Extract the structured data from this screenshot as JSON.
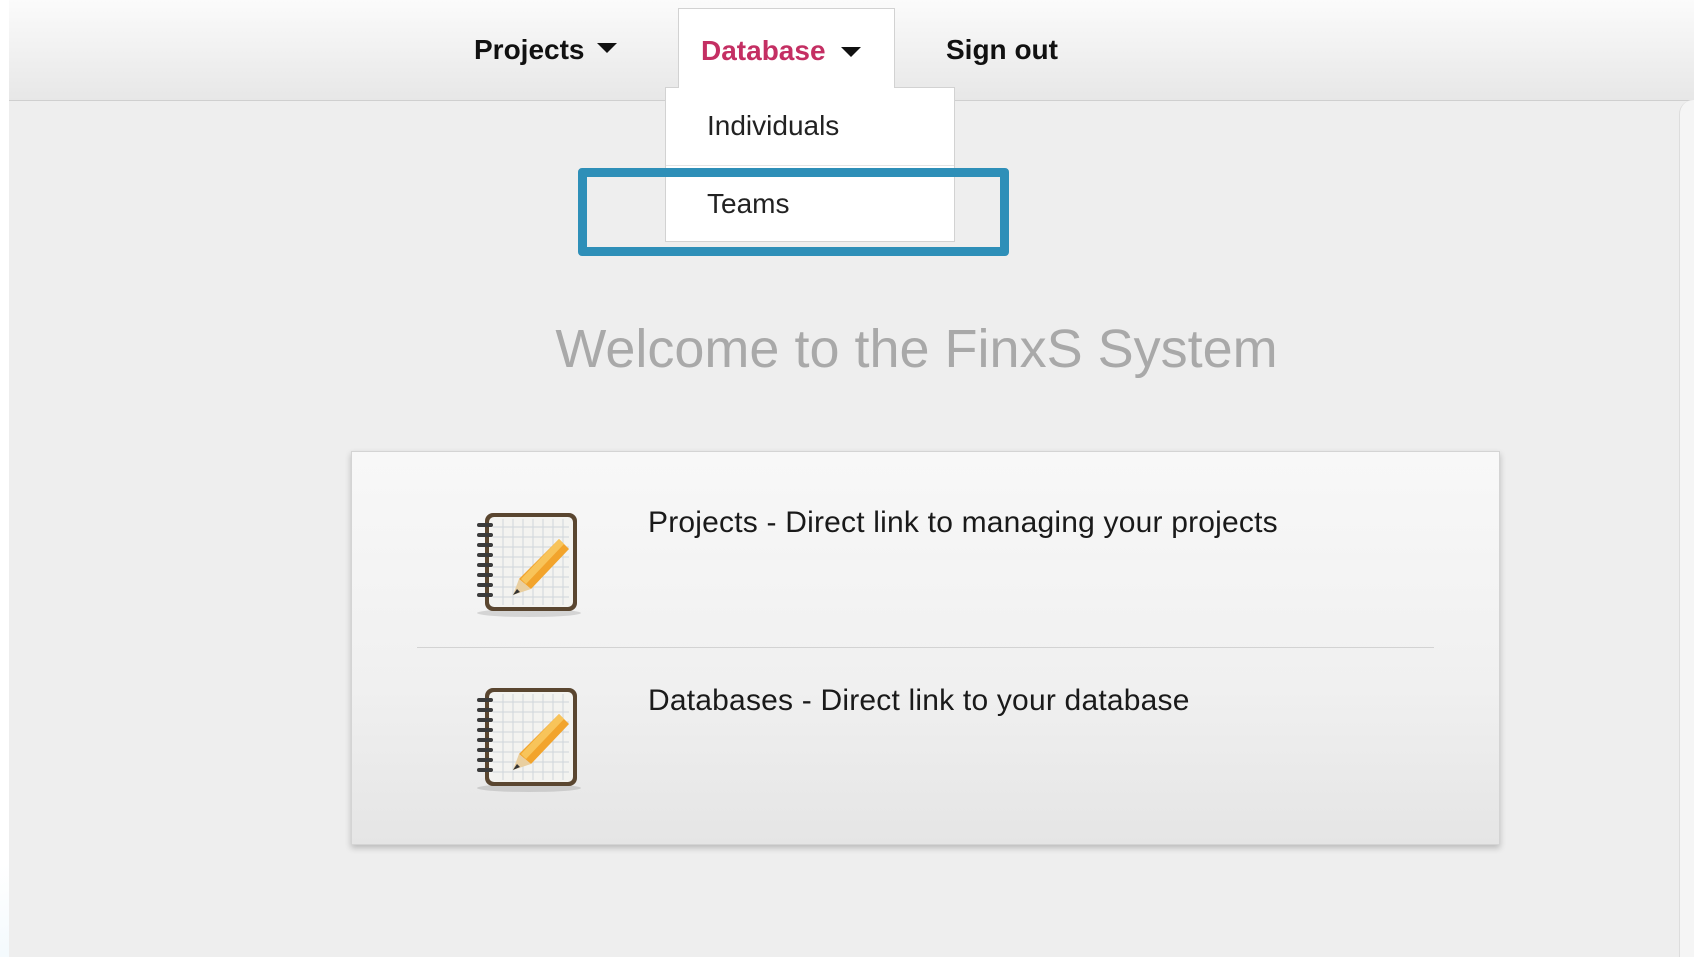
{
  "navbar": {
    "projects_label": "Projects",
    "database_label": "Database",
    "signout_label": "Sign out"
  },
  "dropdown": {
    "items": [
      {
        "label": "Individuals"
      },
      {
        "label": "Teams"
      }
    ]
  },
  "main": {
    "welcome_title": "Welcome to the FinxS System",
    "links": [
      {
        "text": "Projects - Direct link to managing your projects",
        "icon": "notebook-pencil-icon"
      },
      {
        "text": "Databases - Direct link to your database",
        "icon": "notebook-pencil-icon"
      }
    ]
  },
  "colors": {
    "active_nav": "#c42f63",
    "highlight": "#2e8fb8",
    "welcome_text": "#a9a9a9"
  }
}
